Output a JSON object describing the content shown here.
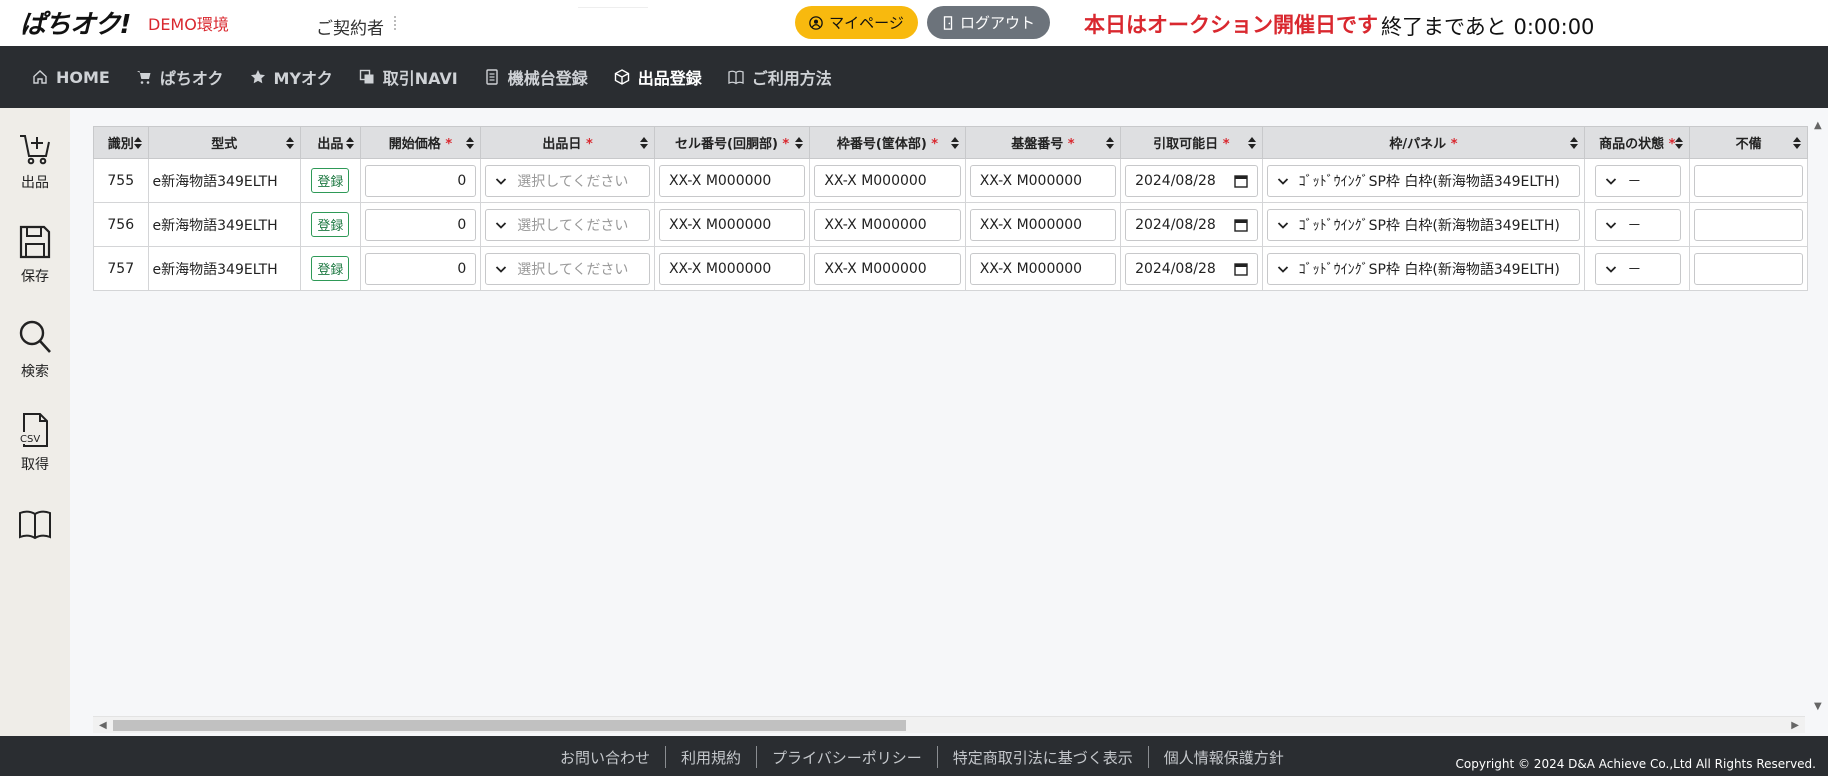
{
  "header": {
    "logo": "ぱちオク!",
    "env_label": "DEMO環境",
    "contract_label": "ご契約者",
    "mypage_label": "マイページ",
    "logout_label": "ログアウト",
    "auction_notice": "本日はオークション開催日です",
    "countdown_label": "終了まであと 0:00:00"
  },
  "nav": {
    "items": [
      {
        "label": "HOME",
        "icon": "home-icon"
      },
      {
        "label": "ぱちオク",
        "icon": "cart-icon"
      },
      {
        "label": "MYオク",
        "icon": "star-icon"
      },
      {
        "label": "取引NAVI",
        "icon": "copy-icon"
      },
      {
        "label": "機械台登録",
        "icon": "machine-icon"
      },
      {
        "label": "出品登録",
        "icon": "box-icon",
        "active": true
      },
      {
        "label": "ご利用方法",
        "icon": "book-icon"
      }
    ]
  },
  "sidebar": {
    "items": [
      {
        "label": "出品",
        "icon": "cart-add-icon"
      },
      {
        "label": "保存",
        "icon": "save-icon"
      },
      {
        "label": "検索",
        "icon": "search-icon"
      },
      {
        "label": "取得",
        "icon": "csv-file-icon",
        "icon_text": "CSV"
      },
      {
        "label": "",
        "icon": "book-icon"
      }
    ]
  },
  "table": {
    "columns": [
      {
        "label": "識別",
        "required": false
      },
      {
        "label": "型式",
        "required": false
      },
      {
        "label": "出品",
        "required": false
      },
      {
        "label": "開始価格",
        "required": true
      },
      {
        "label": "出品日",
        "required": true
      },
      {
        "label": "セル番号(回胴部)",
        "required": true
      },
      {
        "label": "枠番号(筐体部)",
        "required": true
      },
      {
        "label": "基盤番号",
        "required": true
      },
      {
        "label": "引取可能日",
        "required": true
      },
      {
        "label": "枠/パネル",
        "required": true
      },
      {
        "label": "商品の状態",
        "required": true
      },
      {
        "label": "不備",
        "required": false
      }
    ],
    "required_mark": "*",
    "rows": [
      {
        "id": "755",
        "model": "e新海物語349ELTH",
        "register": "登録",
        "start_price": "0",
        "listing_date_placeholder": "選択してください",
        "cell_no": "XX-X M000000",
        "frame_no": "XX-X M000000",
        "board_no": "XX-X M000000",
        "pickup_date": "2024/08/28",
        "frame_panel": "ｺﾞｯﾄﾞｳｲﾝｸﾞSP枠 白枠(新海物語349ELTH)",
        "condition": "－",
        "defect": ""
      },
      {
        "id": "756",
        "model": "e新海物語349ELTH",
        "register": "登録",
        "start_price": "0",
        "listing_date_placeholder": "選択してください",
        "cell_no": "XX-X M000000",
        "frame_no": "XX-X M000000",
        "board_no": "XX-X M000000",
        "pickup_date": "2024/08/28",
        "frame_panel": "ｺﾞｯﾄﾞｳｲﾝｸﾞSP枠 白枠(新海物語349ELTH)",
        "condition": "－",
        "defect": ""
      },
      {
        "id": "757",
        "model": "e新海物語349ELTH",
        "register": "登録",
        "start_price": "0",
        "listing_date_placeholder": "選択してください",
        "cell_no": "XX-X M000000",
        "frame_no": "XX-X M000000",
        "board_no": "XX-X M000000",
        "pickup_date": "2024/08/28",
        "frame_panel": "ｺﾞｯﾄﾞｳｲﾝｸﾞSP枠 白枠(新海物語349ELTH)",
        "condition": "－",
        "defect": ""
      }
    ]
  },
  "footer": {
    "links": [
      "お問い合わせ",
      "利用規約",
      "プライバシーポリシー",
      "特定商取引法に基づく表示",
      "個人情報保護方針"
    ],
    "copyright": "Copyright © 2024 D&A Achieve Co.,Ltd All Rights Reserved."
  },
  "colors": {
    "accent_red": "#d9282f",
    "mypage_yellow": "#f8b90e",
    "nav_dark": "#2a2d31",
    "register_green": "#2e9957"
  }
}
